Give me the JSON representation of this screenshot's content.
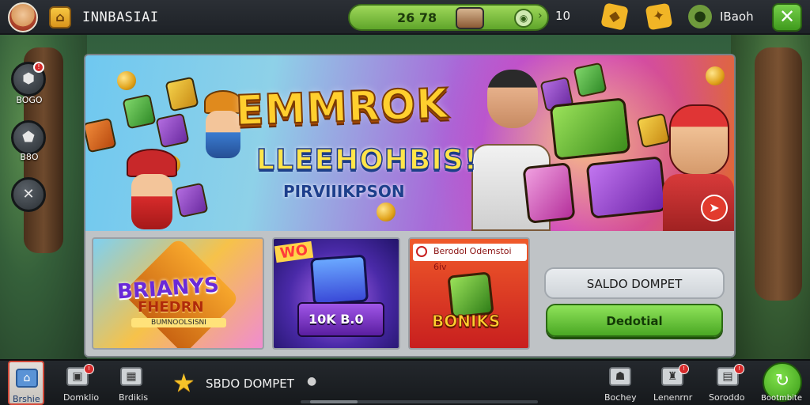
{
  "header": {
    "title": "INNBASIAI",
    "coin_value": "26 78",
    "coin_suffix": "10",
    "coin_count": "10",
    "label_right": "IBaoh"
  },
  "side_buttons": [
    {
      "label": "BOGO"
    },
    {
      "label": "B8O"
    }
  ],
  "banner": {
    "title": "EMMROK",
    "subtitle": "LLEEHOHBIS!",
    "subtitle2": "PIRVIIIKPSON"
  },
  "cards": [
    {
      "title": "BRIANYS",
      "subtitle": "FHEDRN",
      "small": "BUMNOOLSISNI"
    },
    {
      "tag": "WO",
      "value": "10K B.0"
    },
    {
      "header": "Berodol Odemstoi 6iv",
      "title": "BONIKS"
    }
  ],
  "wallet": {
    "saldo_label": "SALDO DOMPET",
    "deposit_label": "Dedotial"
  },
  "bottom_nav": [
    {
      "label": "Brshie"
    },
    {
      "label": "Domklio"
    },
    {
      "label": "Brdikis"
    },
    {
      "label": "Bochey"
    },
    {
      "label": "Lenenrnr"
    },
    {
      "label": "Soroddo"
    },
    {
      "label": "Bootmbite"
    }
  ],
  "bottom_saldo": "SBDO DOMPET",
  "colors": {
    "accent_green": "#5fa52a",
    "alert_red": "#d62b2b",
    "gold": "#ffcf2e"
  },
  "icons": {
    "home": "home-icon",
    "close": "close-icon",
    "star": "star-icon",
    "arrow": "arrow-icon"
  }
}
